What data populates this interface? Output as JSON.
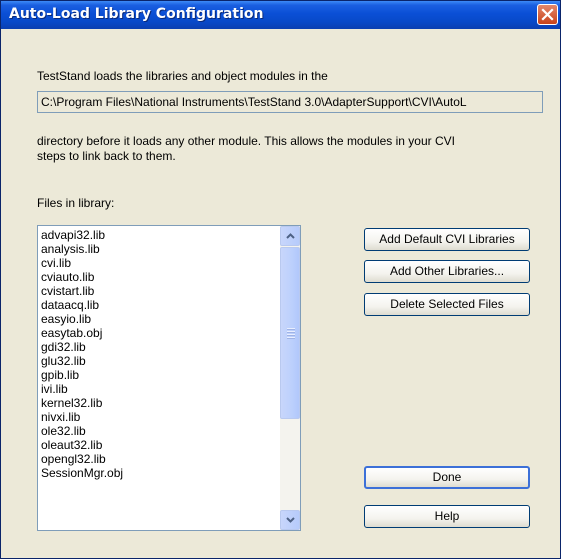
{
  "window": {
    "title": "Auto-Load Library Configuration"
  },
  "description": {
    "line1": "TestStand loads the libraries and object modules in the",
    "path": "C:\\Program Files\\National Instruments\\TestStand 3.0\\AdapterSupport\\CVI\\AutoL",
    "line2": "directory before it loads any other module. This allows the modules in your CVI",
    "line3": "steps to link back to them."
  },
  "files": {
    "label": "Files in library:",
    "items": [
      "advapi32.lib",
      "analysis.lib",
      "cvi.lib",
      "cviauto.lib",
      "cvistart.lib",
      "dataacq.lib",
      "easyio.lib",
      "easytab.obj",
      "gdi32.lib",
      "glu32.lib",
      "gpib.lib",
      "ivi.lib",
      "kernel32.lib",
      "nivxi.lib",
      "ole32.lib",
      "oleaut32.lib",
      "opengl32.lib",
      "SessionMgr.obj"
    ]
  },
  "buttons": {
    "add_default": "Add Default CVI Libraries",
    "add_other": "Add Other Libraries...",
    "delete_selected": "Delete Selected Files",
    "done": "Done",
    "help": "Help"
  }
}
